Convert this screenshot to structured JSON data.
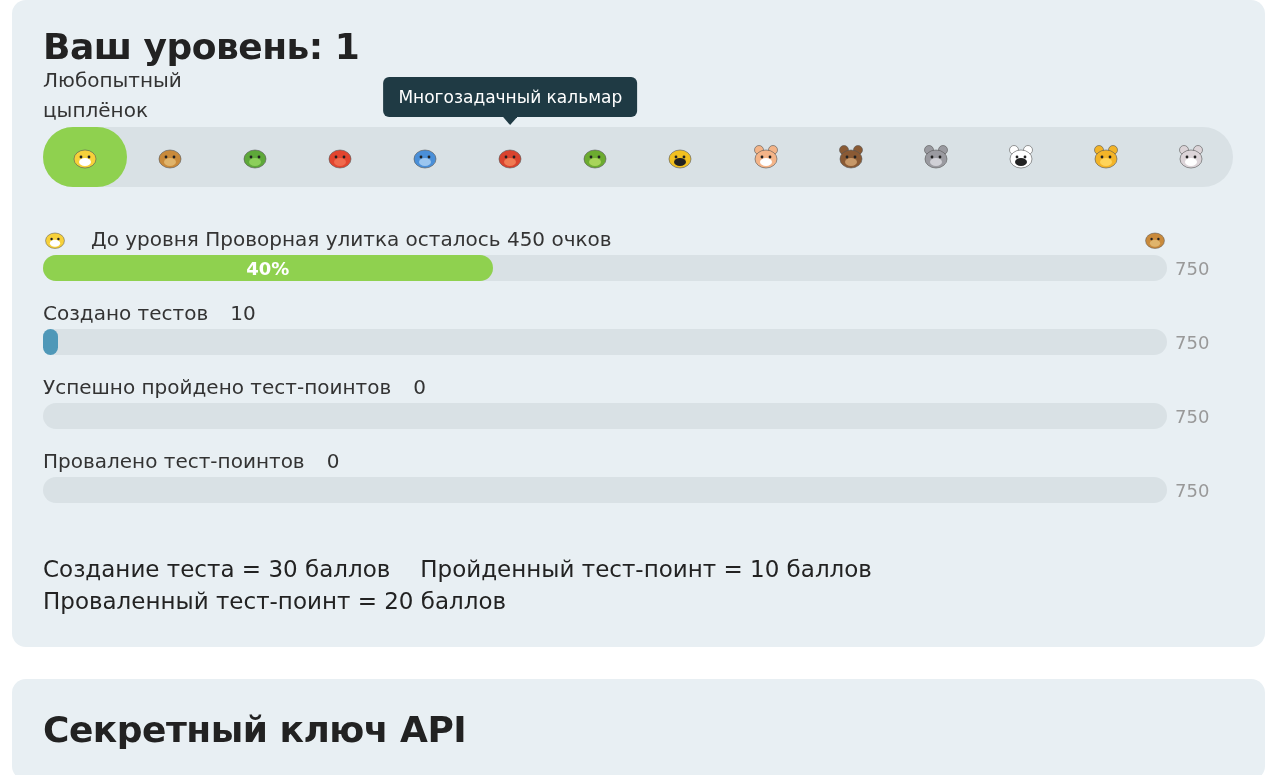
{
  "level_card": {
    "title": "Ваш уровень: 1",
    "levels": [
      {
        "selected": true,
        "caption": "Любопытный цыплёнок"
      },
      {
        "selected": false
      },
      {
        "selected": false
      },
      {
        "selected": false
      },
      {
        "selected": false
      },
      {
        "selected": false,
        "tooltip": "Многозадачный кальмар"
      },
      {
        "selected": false
      },
      {
        "selected": false
      },
      {
        "selected": false
      },
      {
        "selected": false
      },
      {
        "selected": false
      },
      {
        "selected": false
      },
      {
        "selected": false
      },
      {
        "selected": false
      }
    ],
    "next_level": {
      "text": "До уровня Проворная улитка осталось 450 очков",
      "level": 0.4,
      "percent": "40%",
      "max": "750"
    },
    "stats": [
      {
        "label": "Создано тестов",
        "value": "10",
        "level": 0.013,
        "max": "750"
      },
      {
        "label": "Успешно пройдено тест-поинтов",
        "value": "0",
        "level": 0,
        "max": "750"
      },
      {
        "label": "Провалено тест-поинтов",
        "value": "0",
        "level": 0,
        "max": "750"
      }
    ],
    "scoring": [
      "Создание теста = 30 баллов",
      "Пройденный тест-поинт = 10 баллов",
      "Проваленный тест-поинт = 20 баллов"
    ]
  },
  "api_card": {
    "title": "Секретный ключ API"
  }
}
